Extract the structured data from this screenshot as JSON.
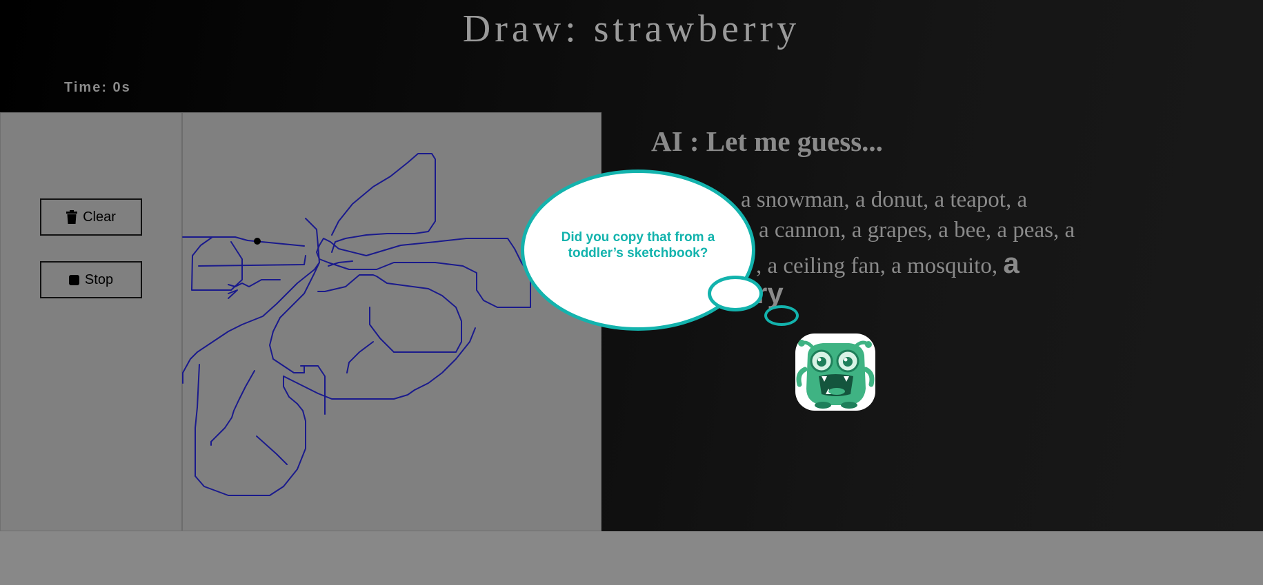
{
  "header": {
    "title": "Draw: strawberry"
  },
  "timer": {
    "text": "Time: 0s"
  },
  "controls": {
    "clear_label": "Clear",
    "stop_label": "Stop"
  },
  "ai": {
    "heading": "AI : Let me guess...",
    "guesses_visible_text": "a snowman, a donut, a teapot, a a cannon, a grapes, a bee, a peas, a , a ceiling fan, a mosquito,",
    "line1": "a snowman, a donut, a teapot, a",
    "line2": "a cannon, a grapes, a bee, a peas, a",
    "line3": ", a ceiling fan, a mosquito,",
    "final_word_a": "a",
    "final_word_tail": "ry"
  },
  "speech_bubble": {
    "text": "Did you copy that from a toddler’s sketchbook?"
  },
  "colors": {
    "accent": "#13b3ad",
    "stroke": "#1a1a8c",
    "panel": "#808080",
    "text_muted": "#8a8a8a"
  },
  "icons": {
    "clear": "trash-icon",
    "stop": "stop-icon",
    "mascot": "monster-mascot"
  }
}
